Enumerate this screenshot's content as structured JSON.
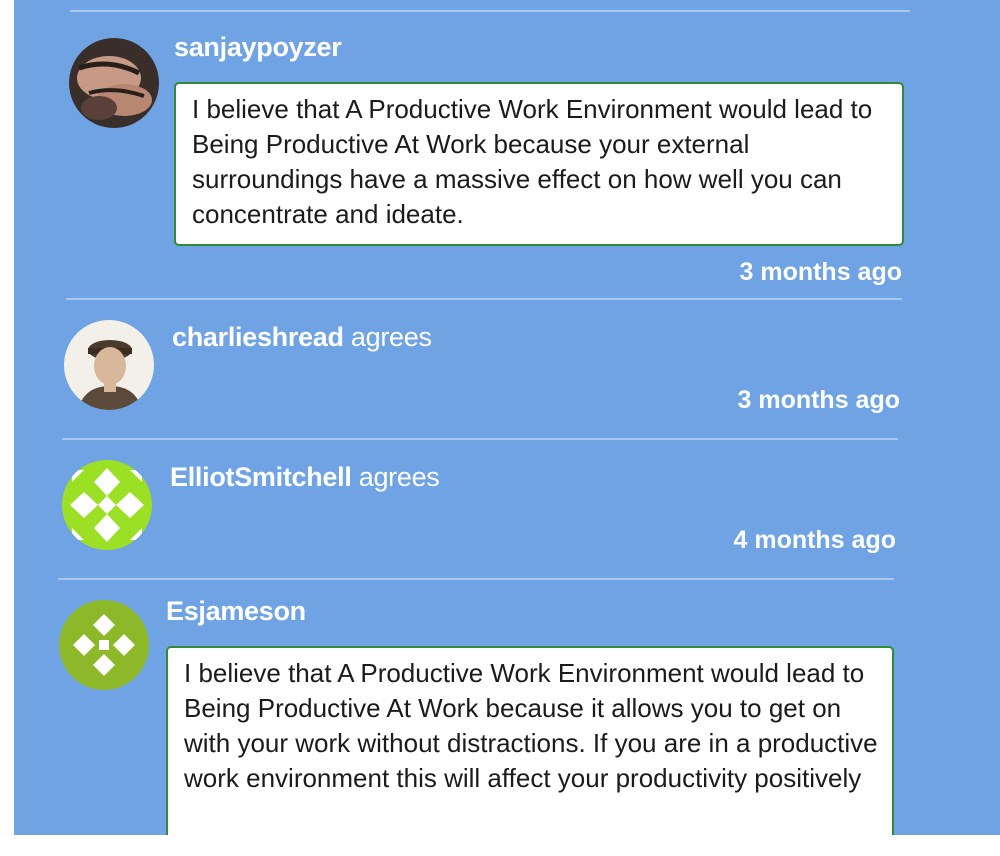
{
  "feed": {
    "posts": [
      {
        "username": "sanjaypoyzer",
        "action": "",
        "comment": "I believe that A Productive Work Environment would lead to Being Productive At Work because your external surroundings have a massive effect on how well you can concentrate and ideate.",
        "time": "3 months ago"
      },
      {
        "username": "charlieshread",
        "action": "agrees",
        "time": "3 months ago"
      },
      {
        "username": "ElliotSmitchell",
        "action": "agrees",
        "time": "4 months ago"
      },
      {
        "username": "Esjameson",
        "action": "",
        "comment": "I believe that A Productive Work Environment would lead to Being Productive At Work because it allows you to get on with your work without distractions. If you are in a productive work environment this will affect your productivity positively"
      }
    ]
  },
  "colors": {
    "panel_bg": "#6fa3e3",
    "divider": "#a9c9f1",
    "bubble_border": "#2f8a3c",
    "text_white": "#ffffff",
    "identicon_green_1": "#9be024",
    "identicon_green_2": "#8cb82a"
  }
}
